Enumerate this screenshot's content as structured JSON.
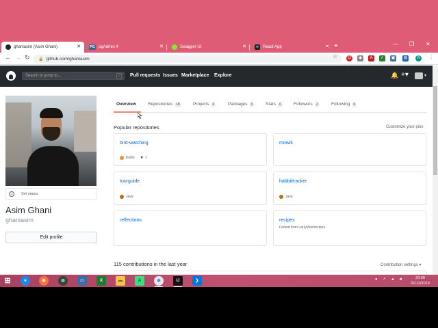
{
  "browser": {
    "tabs": [
      {
        "title": "ghaniasim (Asim Ghani)",
        "favicon": "github-favicon",
        "active": true
      },
      {
        "title": "pgAdmin 4",
        "favicon": "pgadmin-favicon",
        "badge": "PG",
        "active": false
      },
      {
        "title": "Swagger UI",
        "favicon": "swagger-favicon",
        "active": false
      },
      {
        "title": "React App",
        "favicon": "react-favicon",
        "active": false
      }
    ],
    "url": "github.com/ghaniasim",
    "accent": "#de5c76",
    "profile_initial": "A"
  },
  "github": {
    "search_placeholder": "Search or jump to...",
    "search_shortcut": "/",
    "nav": [
      "Pull requests",
      "Issues",
      "Marketplace",
      "Explore"
    ]
  },
  "profile": {
    "set_status": "Set status",
    "name": "Asim Ghani",
    "username": "ghaniasim",
    "edit_button": "Edit profile"
  },
  "profile_tabs": [
    {
      "label": "Overview",
      "count": null,
      "selected": true
    },
    {
      "label": "Repositories",
      "count": "18",
      "selected": false
    },
    {
      "label": "Projects",
      "count": "0",
      "selected": false
    },
    {
      "label": "Packages",
      "count": "0",
      "selected": false
    },
    {
      "label": "Stars",
      "count": "0",
      "selected": false
    },
    {
      "label": "Followers",
      "count": "2",
      "selected": false
    },
    {
      "label": "Following",
      "count": "0",
      "selected": false
    }
  ],
  "popular": {
    "title": "Popular repositories",
    "customize": "Customize your pins",
    "repos": [
      {
        "name": "bird-watching",
        "language": "Kotlin",
        "language_color": "#F18E33",
        "stars": "1",
        "forked_from": ""
      },
      {
        "name": "mowik",
        "language": "",
        "language_color": "",
        "stars": "",
        "forked_from": ""
      },
      {
        "name": "tourguide",
        "language": "Java",
        "language_color": "#b07219",
        "stars": "",
        "forked_from": ""
      },
      {
        "name": "habbittracker",
        "language": "Java",
        "language_color": "#b07219",
        "stars": "",
        "forked_from": ""
      },
      {
        "name": "reflections",
        "language": "",
        "language_color": "",
        "stars": "",
        "forked_from": ""
      },
      {
        "name": "recipes",
        "language": "",
        "language_color": "",
        "stars": "",
        "forked_from": "Forked from LarryMoo/recipes"
      }
    ]
  },
  "contributions": {
    "title": "115 contributions in the last year",
    "settings": "Contribution settings ▾"
  },
  "taskbar": {
    "time": "23:00",
    "date": "01/12/2019"
  }
}
